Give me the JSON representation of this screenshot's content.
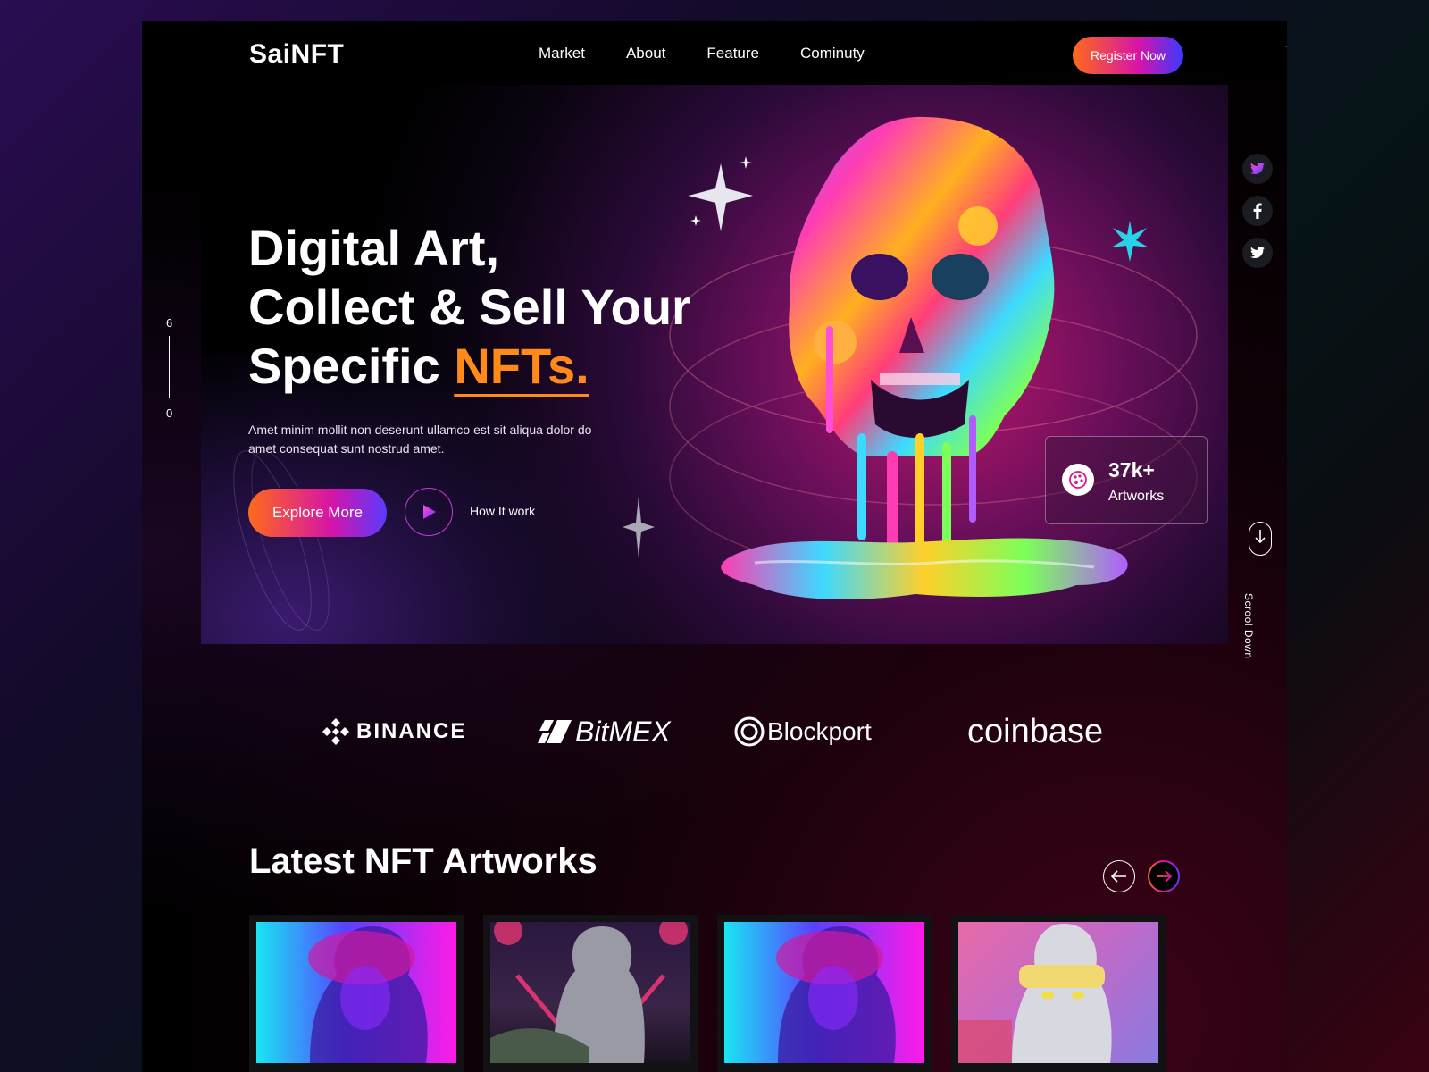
{
  "header": {
    "logo": "SaiNFT",
    "nav": [
      "Market",
      "About",
      "Feature",
      "Cominuty"
    ],
    "register_label": "Register Now"
  },
  "hero": {
    "title_line1": "Digital Art,",
    "title_line2": "Collect & Sell Your",
    "title_line3_prefix": "Specific ",
    "title_accent": "NFTs.",
    "description": "Amet minim mollit non deserunt ullamco est sit aliqua dolor do amet consequat sunt nostrud amet.",
    "explore_label": "Explore More",
    "how_it_work_label": "How It work",
    "stat_value": "37k+",
    "stat_label": "Artworks"
  },
  "slide_indicator": {
    "top": "6",
    "bottom": "0"
  },
  "social": [
    "twitter-icon",
    "facebook-icon",
    "twitter-icon"
  ],
  "scroll_label": "Scrool Down",
  "partners": [
    "BINANCE",
    "BitMEX",
    "Blockport",
    "coinbase"
  ],
  "latest": {
    "title": "Latest NFT Artworks"
  },
  "colors": {
    "accent_orange": "#ff8a1a",
    "gradient_start": "#ff6a1a",
    "gradient_mid": "#d614a8",
    "gradient_end": "#5a3aff",
    "background": "#000000"
  }
}
